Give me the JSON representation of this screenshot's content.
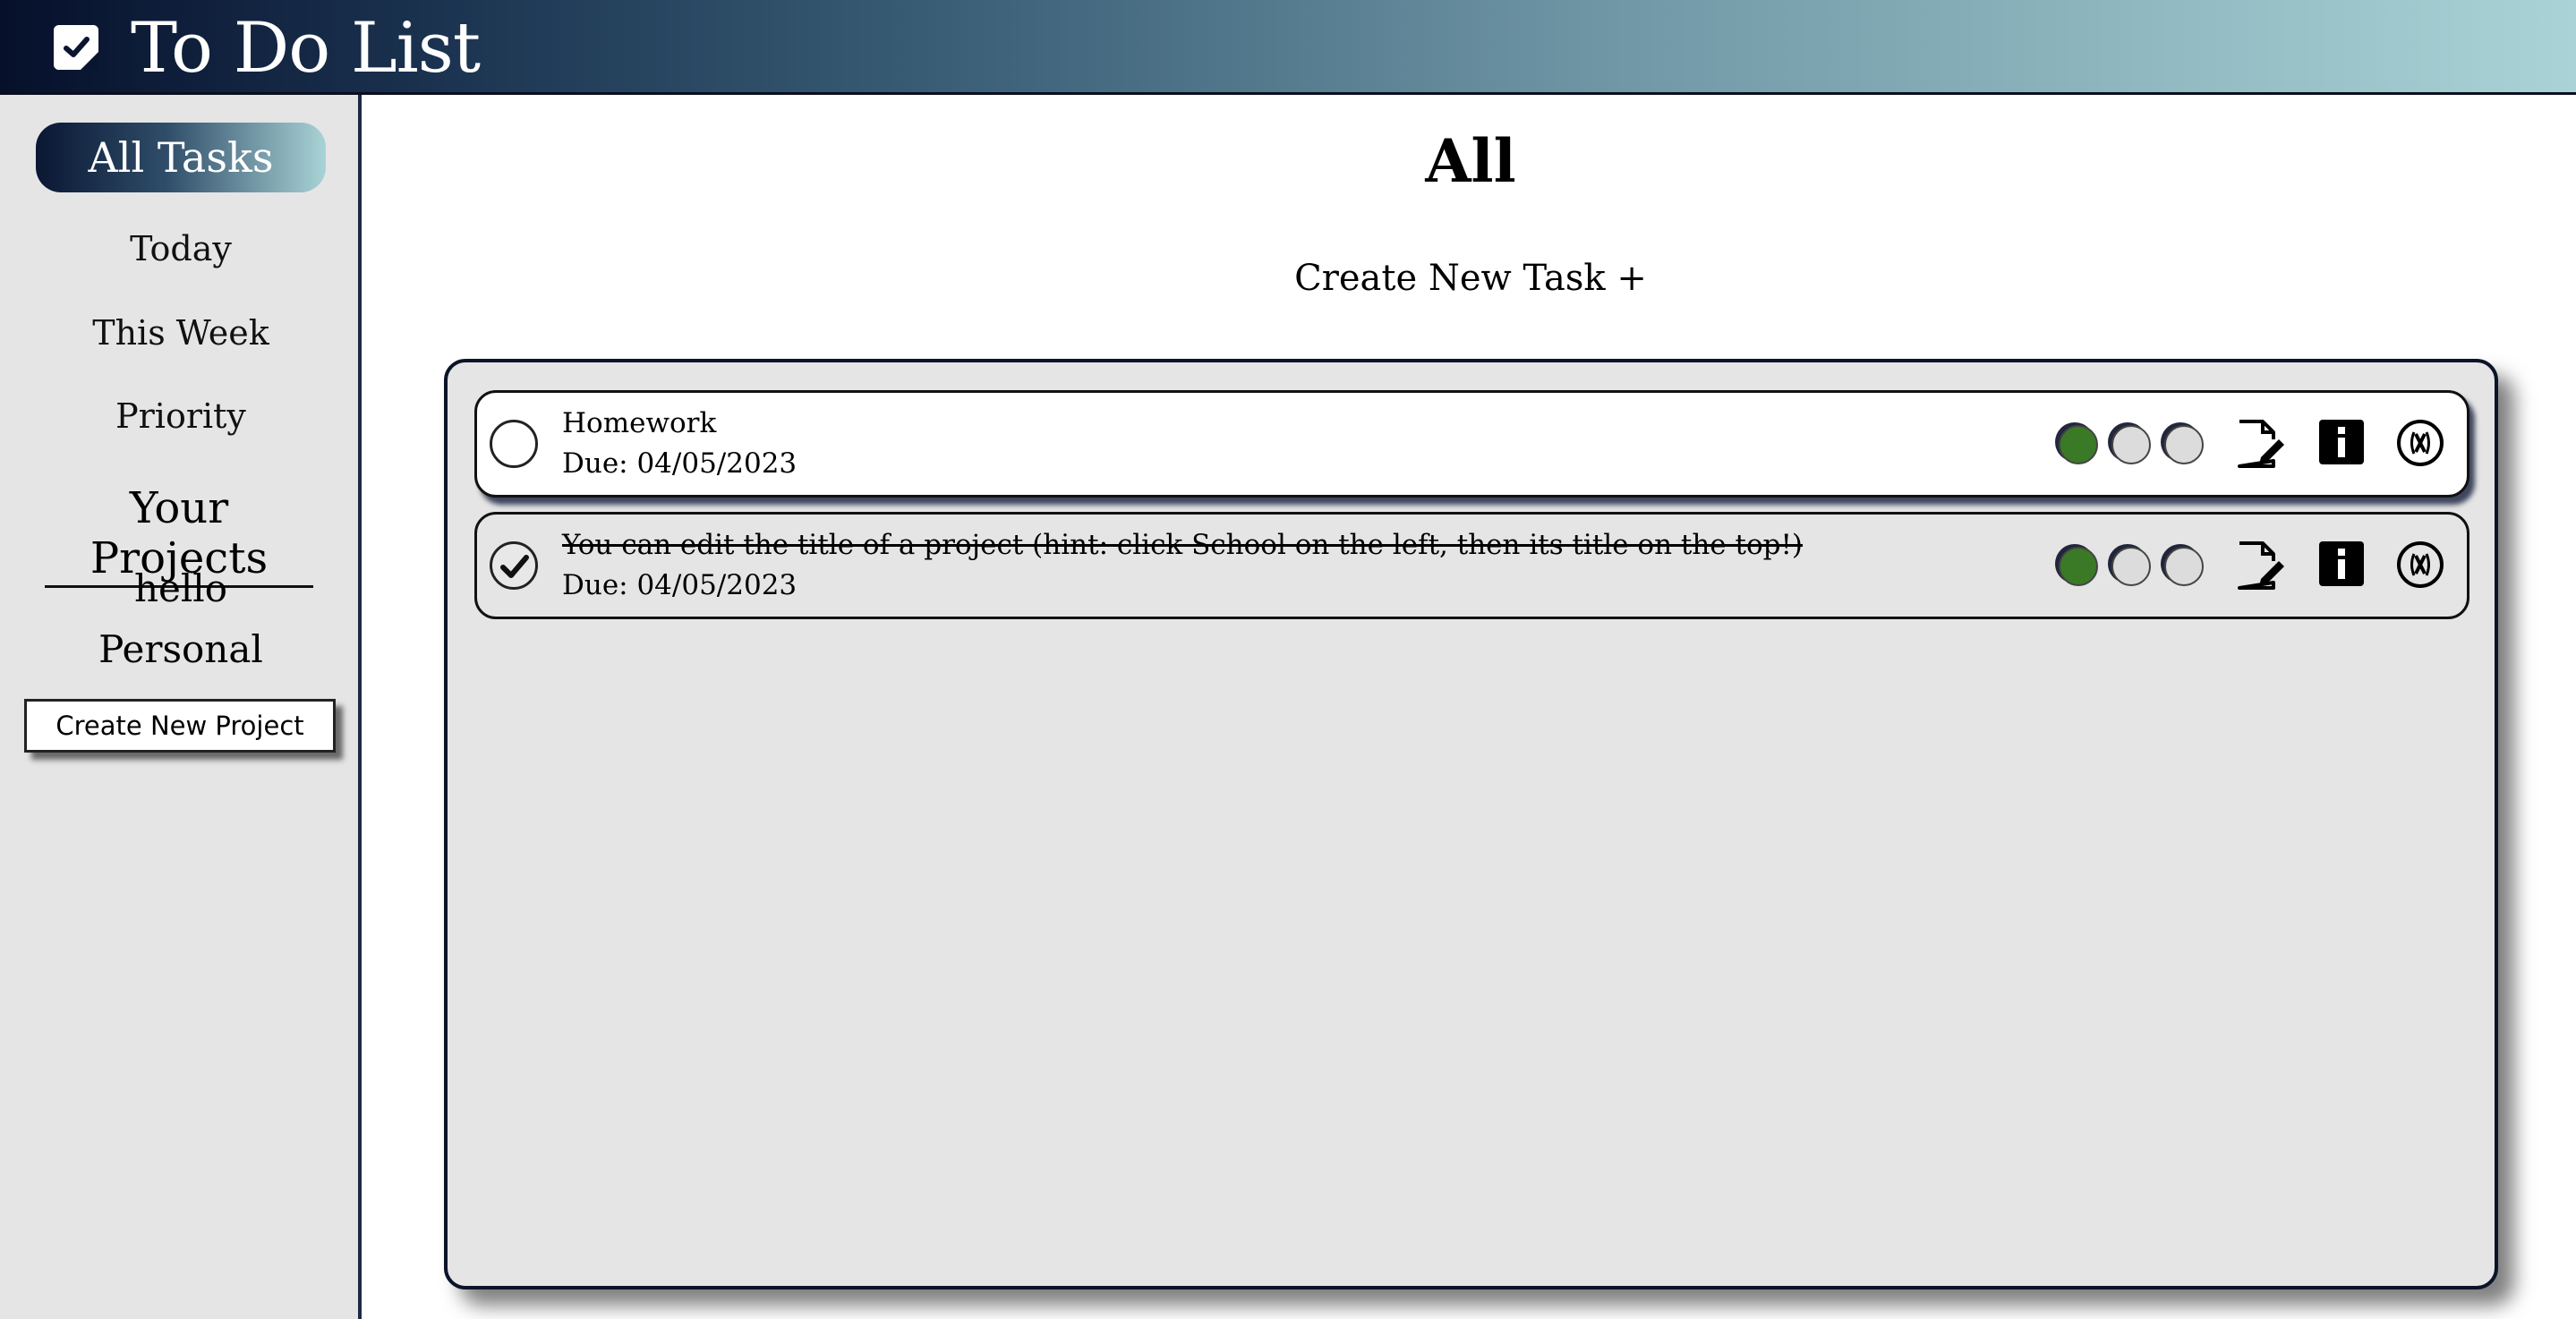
{
  "header": {
    "title": "To Do List",
    "logo_icon": "checkbox-icon"
  },
  "sidebar": {
    "active_item": "All Tasks",
    "items": [
      "Today",
      "This Week",
      "Priority"
    ],
    "projects_heading": "Your Projects",
    "projects": [
      "hello",
      "Personal"
    ],
    "create_project_label": "Create New Project"
  },
  "main": {
    "title": "All",
    "create_task_label": "Create New Task +",
    "tasks": [
      {
        "title": "Homework",
        "due": "Due: 04/05/2023",
        "completed": false,
        "priority": 1
      },
      {
        "title": "You can edit the title of a project (hint: click School on the left, then its title on the top!)",
        "due": "Due: 04/05/2023",
        "completed": true,
        "priority": 1
      }
    ]
  },
  "colors": {
    "header_gradient_start": "#06102b",
    "header_gradient_end": "#a9d3d6",
    "priority_active": "#3a7a26",
    "priority_inactive": "#dcdcdc",
    "panel_bg": "#e5e5e5"
  },
  "icons": {
    "edit": "edit-icon",
    "info": "info-icon",
    "delete": "delete-icon",
    "check": "checkmark-icon"
  }
}
